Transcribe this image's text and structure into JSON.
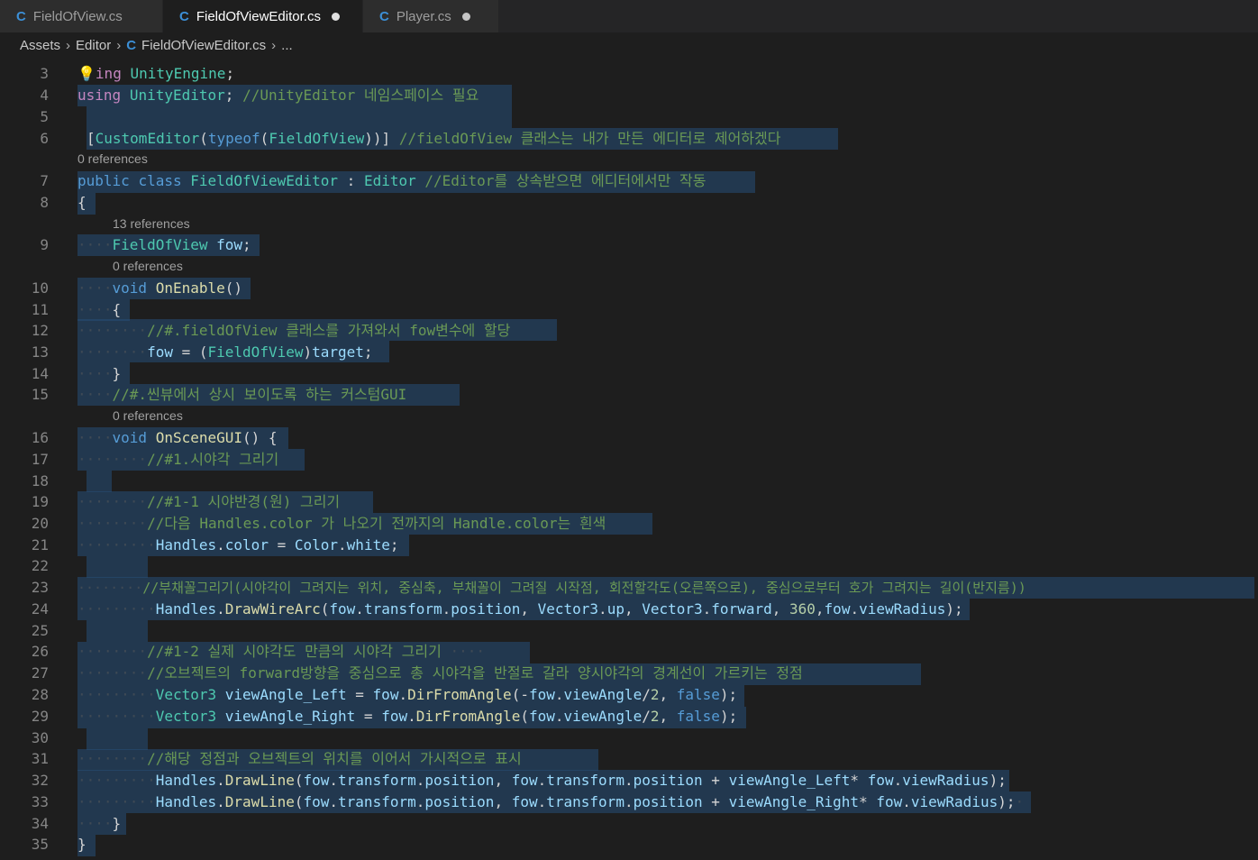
{
  "tabs": [
    {
      "icon": "C",
      "label": "FieldOfView.cs"
    },
    {
      "icon": "C",
      "label": "FieldOfViewEditor.cs"
    },
    {
      "icon": "C",
      "label": "Player.cs"
    }
  ],
  "breadcrumb": {
    "assets": "Assets",
    "editor": "Editor",
    "file": "FieldOfViewEditor.cs",
    "more": "..."
  },
  "refs": {
    "r7": "0 references",
    "r9": "13 references",
    "r10": "0 references",
    "r16": "0 references"
  },
  "line_numbers": [
    "3",
    "4",
    "5",
    "6",
    "7",
    "8",
    "9",
    "10",
    "11",
    "12",
    "13",
    "14",
    "15",
    "16",
    "17",
    "18",
    "19",
    "20",
    "21",
    "22",
    "23",
    "24",
    "25",
    "26",
    "27",
    "28",
    "29",
    "30",
    "31",
    "32",
    "33",
    "34",
    "35"
  ],
  "code": {
    "l3a": "ing",
    "l3b": "UnityEngine",
    "l3c": ";",
    "l4a": "using",
    "l4b": "UnityEditor",
    "l4c": ";",
    "l4d": "//UnityEditor 네임스페이스 필요",
    "l6a": "[",
    "l6b": "CustomEditor",
    "l6c": "(",
    "l6d": "typeof",
    "l6e": "(",
    "l6f": "FieldOfView",
    "l6g": "))]",
    "l6h": "//fieldOfView 클래스는 내가 만든 에디터로 제어하겠다",
    "l7a": "public",
    "l7b": "class",
    "l7c": "FieldOfViewEditor",
    "l7d": ":",
    "l7e": "Editor",
    "l7f": "//Editor를 상속받으면 에디터에서만 작동",
    "l8": "{",
    "l9a": "FieldOfView",
    "l9b": "fow",
    "l9c": ";",
    "l10a": "void",
    "l10b": "OnEnable",
    "l10c": "()",
    "l11": "{",
    "l12": "//#.fieldOfView 클래스를 가져와서 fow변수에 할당",
    "l13a": "fow",
    "l13b": "= (",
    "l13c": "FieldOfView",
    "l13d": ")",
    "l13e": "target",
    "l13f": ";",
    "l14": "}",
    "l15": "//#.씬뷰에서 상시 보이도록 하는 커스텀GUI",
    "l16a": "void",
    "l16b": "OnSceneGUI",
    "l16c": "() {",
    "l17": "//#1.시야각 그리기",
    "l19": "//#1-1 시야반경(원) 그리기",
    "l20": "//다음 Handles.color 가 나오기 전까지의 Handle.color는 흰색",
    "l21a": "Handles",
    "l21b": ".",
    "l21c": "color",
    "l21d": " = ",
    "l21e": "Color",
    "l21f": ".",
    "l21g": "white",
    "l21h": ";",
    "l23": "//부채꼴그리기(시야각이 그려지는 위치, 중심축, 부채꼴이 그려질 시작점, 회전할각도(오른쪽으로), 중심으로부터 호가 그려지는 길이(반지름))",
    "l24a": "Handles",
    "l24b": ".",
    "l24c": "DrawWireArc",
    "l24d": "(",
    "l24e": "fow",
    "l24f": ".",
    "l24g": "transform",
    "l24h": ".",
    "l24i": "position",
    "l24j": ", ",
    "l24k": "Vector3",
    "l24l": ".",
    "l24m": "up",
    "l24n": ", ",
    "l24o": "Vector3",
    "l24p": ".",
    "l24q": "forward",
    "l24r": ", ",
    "l24s": "360",
    "l24t": ",",
    "l24u": "fow",
    "l24v": ".",
    "l24w": "viewRadius",
    "l24x": ");",
    "l26": "//#1-2 실제 시야각도 만큼의 시야각 그리기",
    "l27": "//오브젝트의 forward방향을 중심으로 총 시야각을 반절로 갈라 양시야각의 경계선이 가르키는 정점",
    "l28a": "Vector3",
    "l28b": "viewAngle_Left",
    "l28c": " = ",
    "l28d": "fow",
    "l28e": ".",
    "l28f": "DirFromAngle",
    "l28g": "(-",
    "l28h": "fow",
    "l28i": ".",
    "l28j": "viewAngle",
    "l28k": "/",
    "l28l": "2",
    "l28m": ", ",
    "l28n": "false",
    "l28o": ");",
    "l29a": "Vector3",
    "l29b": "viewAngle_Right",
    "l29c": " = ",
    "l29d": "fow",
    "l29e": ".",
    "l29f": "DirFromAngle",
    "l29g": "(",
    "l29h": "fow",
    "l29i": ".",
    "l29j": "viewAngle",
    "l29k": "/",
    "l29l": "2",
    "l29m": ", ",
    "l29n": "false",
    "l29o": ");",
    "l31": "//해당 정점과 오브젝트의 위치를 이어서 가시적으로 표시",
    "l32a": "Handles",
    "l32b": ".",
    "l32c": "DrawLine",
    "l32d": "(",
    "l32e": "fow",
    "l32f": ".",
    "l32g": "transform",
    "l32h": ".",
    "l32i": "position",
    "l32j": ", ",
    "l32k": "fow",
    "l32l": ".",
    "l32m": "transform",
    "l32n": ".",
    "l32o": "position",
    "l32p": " + ",
    "l32q": "viewAngle_Left",
    "l32r": "* ",
    "l32s": "fow",
    "l32t": ".",
    "l32u": "viewRadius",
    "l32v": ");",
    "l33a": "Handles",
    "l33b": ".",
    "l33c": "DrawLine",
    "l33d": "(",
    "l33e": "fow",
    "l33f": ".",
    "l33g": "transform",
    "l33h": ".",
    "l33i": "position",
    "l33j": ", ",
    "l33k": "fow",
    "l33l": ".",
    "l33m": "transform",
    "l33n": ".",
    "l33o": "position",
    "l33p": " + ",
    "l33q": "viewAngle_Right",
    "l33r": "* ",
    "l33s": "fow",
    "l33t": ".",
    "l33u": "viewRadius",
    "l33v": ");",
    "l34": "}",
    "l35": "}"
  },
  "colors": {
    "keyword": "#569cd6",
    "control": "#c586c0",
    "type": "#4ec9b0",
    "function": "#dcdcaa",
    "comment": "#6a9955",
    "variable": "#9cdcfe",
    "number": "#b5cea8",
    "selection": "#264f78"
  }
}
